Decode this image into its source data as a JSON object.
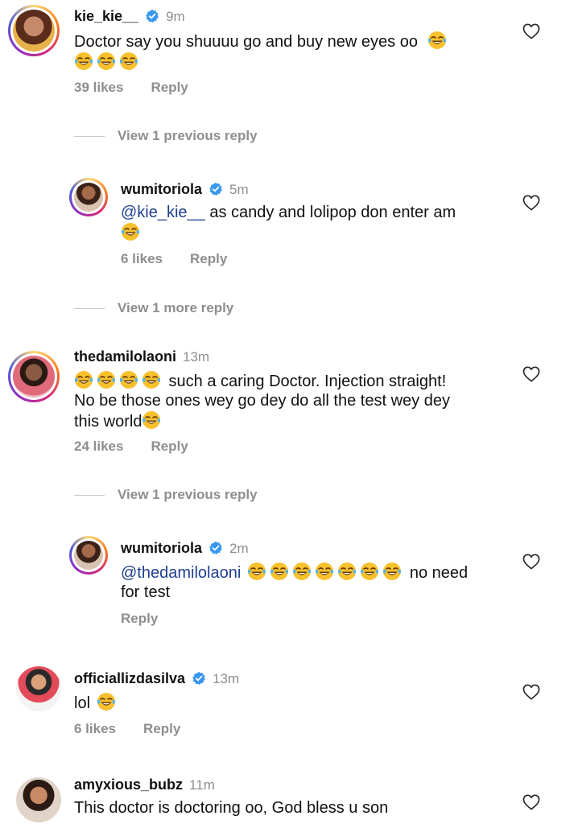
{
  "comments": [
    {
      "username": "kie_kie__",
      "verified": true,
      "time": "9m",
      "text_line1": "Doctor say you shuuuu go and buy new eyes oo",
      "likes": "39 likes",
      "reply": "Reply",
      "emoji_name": "face-with-tears-of-joy"
    },
    {
      "username": "wumitoriola",
      "verified": true,
      "time": "5m",
      "mention": "@kie_kie__",
      "text": " as candy and lolipop don enter am",
      "likes": "6 likes",
      "reply": "Reply"
    },
    {
      "username": "thedamilolaoni",
      "verified": false,
      "time": "13m",
      "text_line1": " such a caring Doctor. Injection straight!",
      "text_line2": "No be those ones wey go dey do all the test wey dey",
      "text_line3": "this world",
      "likes": "24 likes",
      "reply": "Reply"
    },
    {
      "username": "wumitoriola",
      "verified": true,
      "time": "2m",
      "mention": "@thedamilolaoni",
      "text_line1": " no need",
      "text_line2": "for test",
      "reply": "Reply"
    },
    {
      "username": "officiallizdasilva",
      "verified": true,
      "time": "13m",
      "text": "lol",
      "likes": "6 likes",
      "reply": "Reply"
    },
    {
      "username": "amyxious_bubz",
      "verified": false,
      "time": "11m",
      "text": "This doctor is doctoring oo, God bless u son"
    }
  ],
  "view_more": {
    "first": "View 1 previous reply",
    "second": "View 1 more reply",
    "third": "View 1 previous reply"
  },
  "colors": {
    "username": "#111111",
    "secondary": "#8e8e8e",
    "mention": "#1f3f8f",
    "verified_badge": "#3897f0"
  }
}
